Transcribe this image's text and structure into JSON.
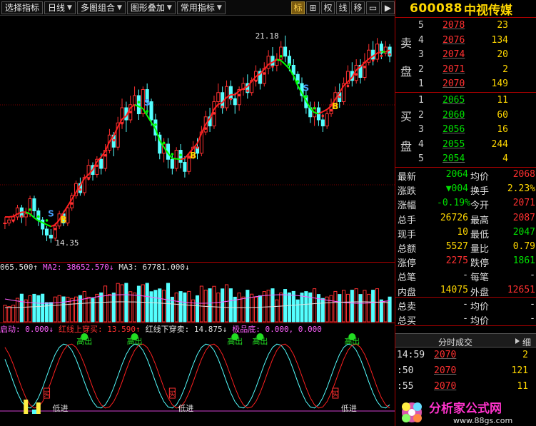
{
  "toolbar": {
    "buttons": [
      {
        "label": "选择指标",
        "dropdown": false
      },
      {
        "label": "日线",
        "dropdown": true
      },
      {
        "label": "多图组合",
        "dropdown": true
      },
      {
        "label": "图形叠加",
        "dropdown": true
      },
      {
        "label": "常用指标",
        "dropdown": true
      }
    ],
    "icons": [
      {
        "label": "标",
        "name": "mark-tab",
        "active": true
      },
      {
        "label": "⊞",
        "name": "grid-icon",
        "active": false
      },
      {
        "label": "权",
        "name": "rights-tab",
        "active": false
      },
      {
        "label": "线",
        "name": "line-tab",
        "active": false
      },
      {
        "label": "移",
        "name": "move-tab",
        "active": false
      },
      {
        "label": "▭",
        "name": "window-icon",
        "active": false
      },
      {
        "label": "▶",
        "name": "play-icon",
        "active": false
      }
    ]
  },
  "stock": {
    "code": "600088",
    "name": "中视传媒"
  },
  "chart_data": {
    "type": "candlestick",
    "main": {
      "ylim": [
        14.0,
        21.6
      ],
      "high_label": "21.18",
      "low_label": "14.35",
      "signals": [
        {
          "text": "S",
          "bar": 11,
          "color": "#4aa3ff"
        },
        {
          "text": "B",
          "bar": 14,
          "color": "#ffd700"
        },
        {
          "text": "S",
          "bar": 34,
          "color": "#4aa3ff"
        },
        {
          "text": "B",
          "bar": 45,
          "color": "#ffd700"
        },
        {
          "text": "S",
          "bar": 72,
          "color": "#4aa3ff"
        },
        {
          "text": "B",
          "bar": 79,
          "color": "#ffd700"
        }
      ],
      "candles": [
        [
          15.0,
          15.0,
          15.2,
          14.8
        ],
        [
          15.0,
          15.1,
          15.2,
          14.9
        ],
        [
          15.1,
          15.2,
          15.3,
          15.0
        ],
        [
          15.2,
          15.5,
          15.6,
          15.1
        ],
        [
          15.5,
          15.2,
          15.6,
          15.0
        ],
        [
          15.2,
          15.3,
          15.5,
          14.9
        ],
        [
          15.3,
          15.8,
          15.9,
          15.2
        ],
        [
          15.8,
          15.4,
          15.9,
          15.2
        ],
        [
          15.4,
          15.1,
          15.5,
          14.9
        ],
        [
          15.1,
          14.8,
          15.2,
          14.6
        ],
        [
          14.8,
          14.6,
          14.9,
          14.4
        ],
        [
          14.6,
          14.5,
          14.8,
          14.35
        ],
        [
          14.5,
          14.9,
          15.0,
          14.4
        ],
        [
          14.9,
          15.3,
          15.4,
          14.8
        ],
        [
          15.3,
          15.0,
          15.4,
          14.9
        ],
        [
          15.0,
          15.5,
          15.6,
          14.9
        ],
        [
          15.5,
          15.9,
          16.0,
          15.4
        ],
        [
          15.9,
          16.3,
          16.4,
          15.8
        ],
        [
          16.3,
          16.0,
          16.5,
          15.9
        ],
        [
          16.0,
          16.5,
          16.6,
          15.9
        ],
        [
          16.5,
          16.9,
          17.1,
          16.4
        ],
        [
          16.9,
          16.6,
          17.0,
          16.4
        ],
        [
          16.6,
          17.1,
          17.2,
          16.5
        ],
        [
          17.1,
          16.8,
          17.3,
          16.6
        ],
        [
          16.8,
          17.4,
          17.6,
          16.7
        ],
        [
          17.4,
          17.9,
          18.1,
          17.3
        ],
        [
          17.9,
          17.5,
          18.0,
          17.2
        ],
        [
          17.5,
          18.3,
          18.5,
          17.4
        ],
        [
          18.3,
          18.8,
          19.1,
          18.1
        ],
        [
          18.8,
          18.4,
          19.0,
          18.0
        ],
        [
          18.4,
          18.9,
          19.2,
          18.3
        ],
        [
          18.9,
          19.2,
          19.5,
          18.7
        ],
        [
          19.2,
          18.6,
          19.4,
          18.4
        ],
        [
          18.6,
          19.4,
          19.5,
          18.5
        ],
        [
          19.4,
          19.0,
          19.6,
          18.6
        ],
        [
          19.0,
          18.4,
          19.1,
          18.2
        ],
        [
          18.4,
          17.9,
          18.6,
          17.7
        ],
        [
          17.9,
          17.3,
          18.0,
          17.1
        ],
        [
          17.3,
          17.6,
          17.8,
          17.0
        ],
        [
          17.6,
          17.1,
          17.8,
          16.8
        ],
        [
          17.1,
          16.8,
          17.3,
          16.6
        ],
        [
          16.8,
          17.4,
          17.5,
          16.7
        ],
        [
          17.4,
          17.0,
          17.6,
          16.8
        ],
        [
          17.0,
          16.7,
          17.2,
          16.5
        ],
        [
          16.7,
          17.2,
          17.3,
          16.6
        ],
        [
          17.2,
          17.5,
          17.7,
          17.1
        ],
        [
          17.5,
          17.3,
          17.8,
          17.1
        ],
        [
          17.3,
          18.0,
          18.2,
          17.2
        ],
        [
          18.0,
          18.5,
          18.7,
          17.9
        ],
        [
          18.5,
          18.2,
          18.8,
          18.0
        ],
        [
          18.2,
          19.0,
          19.2,
          18.1
        ],
        [
          19.0,
          19.3,
          19.6,
          18.8
        ],
        [
          19.3,
          18.8,
          19.5,
          18.6
        ],
        [
          18.8,
          19.5,
          19.7,
          18.7
        ],
        [
          19.5,
          19.1,
          19.7,
          18.9
        ],
        [
          19.1,
          18.9,
          19.3,
          18.6
        ],
        [
          18.9,
          19.4,
          19.5,
          18.7
        ],
        [
          19.4,
          19.6,
          19.8,
          19.2
        ],
        [
          19.6,
          19.3,
          19.9,
          19.1
        ],
        [
          19.3,
          19.7,
          19.8,
          19.2
        ],
        [
          19.7,
          20.0,
          20.2,
          19.5
        ],
        [
          20.0,
          19.6,
          20.1,
          19.4
        ],
        [
          19.6,
          20.1,
          20.3,
          19.5
        ],
        [
          20.1,
          20.5,
          20.7,
          19.9
        ],
        [
          20.5,
          20.2,
          20.8,
          20.0
        ],
        [
          20.2,
          20.4,
          20.6,
          20.0
        ],
        [
          20.4,
          20.8,
          21.0,
          20.2
        ],
        [
          20.8,
          20.5,
          21.18,
          20.3
        ],
        [
          20.5,
          20.2,
          20.7,
          20.0
        ],
        [
          20.2,
          19.9,
          20.4,
          19.7
        ],
        [
          19.9,
          19.6,
          20.0,
          19.4
        ],
        [
          19.6,
          19.2,
          19.8,
          19.0
        ],
        [
          19.2,
          18.8,
          19.4,
          18.6
        ],
        [
          18.8,
          18.5,
          19.0,
          18.3
        ],
        [
          18.5,
          18.8,
          19.0,
          18.2
        ],
        [
          18.8,
          18.4,
          19.0,
          18.2
        ],
        [
          18.4,
          18.2,
          18.6,
          18.0
        ],
        [
          18.2,
          18.6,
          18.7,
          18.1
        ],
        [
          18.6,
          18.9,
          19.1,
          18.5
        ],
        [
          18.9,
          19.3,
          19.5,
          18.8
        ],
        [
          19.3,
          19.0,
          19.6,
          18.8
        ],
        [
          19.0,
          19.6,
          19.8,
          18.9
        ],
        [
          19.6,
          20.0,
          20.2,
          19.5
        ],
        [
          20.0,
          19.7,
          20.3,
          19.5
        ],
        [
          19.7,
          20.2,
          20.4,
          19.6
        ],
        [
          20.2,
          19.8,
          20.4,
          19.6
        ],
        [
          19.8,
          20.3,
          20.6,
          19.7
        ],
        [
          20.3,
          20.7,
          20.9,
          20.2
        ],
        [
          20.7,
          20.4,
          21.0,
          20.2
        ],
        [
          20.4,
          20.9,
          21.1,
          20.3
        ],
        [
          20.9,
          20.6,
          21.0,
          20.4
        ],
        [
          20.6,
          20.8,
          21.0,
          20.5
        ],
        [
          20.8,
          20.5,
          20.9,
          20.3
        ]
      ]
    },
    "volume_legend": [
      {
        "text": "065.500↑",
        "color": "#e0e0e0"
      },
      {
        "text": "MA2: 38652.570↓",
        "color": "#ff60ff"
      },
      {
        "text": "MA3: 67781.000↓",
        "color": "#e0e0e0"
      }
    ],
    "indicator_legend": [
      {
        "text": "启动: 0.000↓",
        "color": "#ff60ff"
      },
      {
        "text": "红线上穿买: 13.590↑",
        "color": "#ff3030"
      },
      {
        "text": "红线下穿卖: 14.875↓",
        "color": "#e0e0e0"
      },
      {
        "text": "极品底: 0.000, 0.000",
        "color": "#ff60ff"
      }
    ],
    "indicator_labels": {
      "high": "高出",
      "low": "低进",
      "buy": "买"
    }
  },
  "orderbook": {
    "sell_label_top": "卖",
    "sell_label_bottom": "盘",
    "buy_label_top": "买",
    "buy_label_bottom": "盘",
    "asks": [
      {
        "level": "5",
        "price": "2078",
        "vol": "23"
      },
      {
        "level": "4",
        "price": "2076",
        "vol": "134"
      },
      {
        "level": "3",
        "price": "2074",
        "vol": "20"
      },
      {
        "level": "2",
        "price": "2071",
        "vol": "2"
      },
      {
        "level": "1",
        "price": "2070",
        "vol": "149"
      }
    ],
    "bids": [
      {
        "level": "1",
        "price": "2065",
        "vol": "11"
      },
      {
        "level": "2",
        "price": "2060",
        "vol": "60"
      },
      {
        "level": "3",
        "price": "2056",
        "vol": "16"
      },
      {
        "level": "4",
        "price": "2055",
        "vol": "244"
      },
      {
        "level": "5",
        "price": "2054",
        "vol": "4"
      }
    ]
  },
  "quote": [
    {
      "k": "最新",
      "v": "2064",
      "vc": "grn",
      "k2": "均价",
      "v2": "2068",
      "v2c": "red"
    },
    {
      "k": "涨跌",
      "v": "▼004",
      "vc": "grn",
      "k2": "换手",
      "v2": "2.23%",
      "v2c": "yel"
    },
    {
      "k": "涨幅",
      "v": "-0.19%",
      "vc": "grn",
      "k2": "今开",
      "v2": "2071",
      "v2c": "red"
    },
    {
      "k": "总手",
      "v": "26726",
      "vc": "yel",
      "k2": "最高",
      "v2": "2087",
      "v2c": "red"
    },
    {
      "k": "现手",
      "v": "10",
      "vc": "yel",
      "k2": "最低",
      "v2": "2047",
      "v2c": "grn"
    },
    {
      "k": "总额",
      "v": "5527",
      "vc": "yel",
      "k2": "量比",
      "v2": "0.79",
      "v2c": "yel"
    },
    {
      "k": "涨停",
      "v": "2275",
      "vc": "red",
      "k2": "跌停",
      "v2": "1861",
      "v2c": "grn"
    },
    {
      "k": "总笔",
      "v": "-",
      "vc": "wht",
      "k2": "每笔",
      "v2": "-",
      "v2c": "wht"
    },
    {
      "k": "内盘",
      "v": "14075",
      "vc": "yel",
      "k2": "外盘",
      "v2": "12651",
      "v2c": "red"
    },
    {
      "k": "总卖",
      "v": "-",
      "vc": "wht",
      "k2": "均价",
      "v2": "-",
      "v2c": "wht"
    },
    {
      "k": "总买",
      "v": "-",
      "vc": "wht",
      "k2": "均价",
      "v2": "-",
      "v2c": "wht"
    }
  ],
  "ticks_tab": {
    "label": "分时成交",
    "detail": "细"
  },
  "ticks": [
    {
      "time": "14:59",
      "price": "2070",
      "qty": "2"
    },
    {
      "time": ":50",
      "price": "2070",
      "qty": "121"
    },
    {
      "time": ":55",
      "price": "2070",
      "qty": "11"
    }
  ],
  "watermark": {
    "text": "分析家公式网",
    "url": "www.88gs.com"
  }
}
